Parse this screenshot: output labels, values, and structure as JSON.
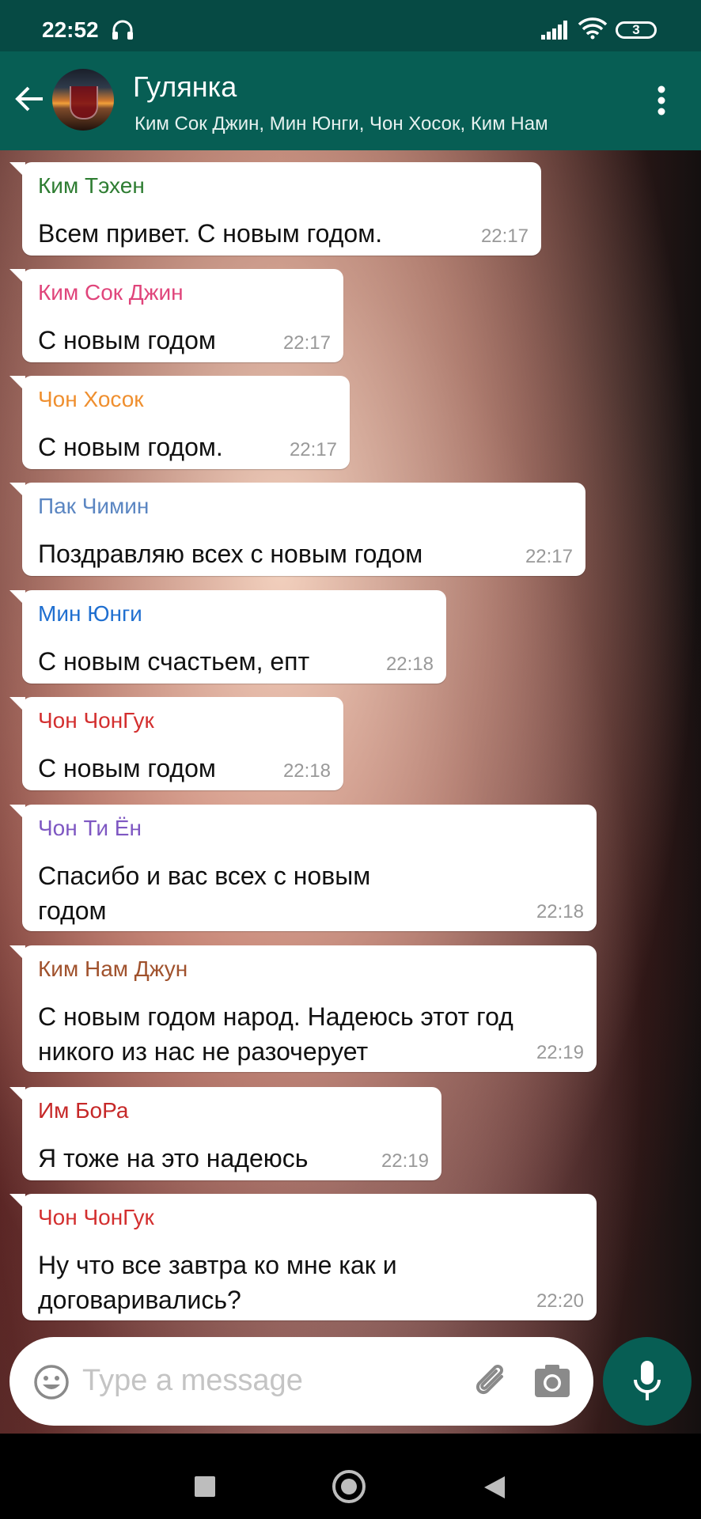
{
  "status_bar": {
    "time": "22:52",
    "battery": "3"
  },
  "header": {
    "title": "Гулянка",
    "subtitle": "Ким Сок Джин, Мин Юнги, Чон Хосок, Ким Нам"
  },
  "messages": [
    {
      "sender": "Ким Тэхен",
      "sender_color": "#2e7d32",
      "lines": [
        "Всем привет. С новым годом."
      ],
      "time": "22:17"
    },
    {
      "sender": "Ким Сок Джин",
      "sender_color": "#e0457b",
      "lines": [
        "С новым годом"
      ],
      "time": "22:17"
    },
    {
      "sender": "Чон Хосок",
      "sender_color": "#ef8f2f",
      "lines": [
        "С новым годом."
      ],
      "time": "22:17"
    },
    {
      "sender": "Пак Чимин",
      "sender_color": "#5b86c2",
      "lines": [
        "Поздравляю всех с новым годом"
      ],
      "time": "22:17"
    },
    {
      "sender": "Мин Юнги",
      "sender_color": "#1f6fd0",
      "lines": [
        "С новым счастьем, епт"
      ],
      "time": "22:18"
    },
    {
      "sender": "Чон ЧонГук",
      "sender_color": "#d32f2f",
      "lines": [
        "С новым годом"
      ],
      "time": "22:18"
    },
    {
      "sender": "Чон Ти Ён",
      "sender_color": "#7e57c2",
      "lines": [
        "Спасибо и вас всех с новым",
        "годом"
      ],
      "time": "22:18"
    },
    {
      "sender": "Ким Нам Джун",
      "sender_color": "#a0522d",
      "lines": [
        "С новым годом народ. Надеюсь этот год",
        "никого из нас не разочерует"
      ],
      "time": "22:19"
    },
    {
      "sender": "Им БоРа",
      "sender_color": "#c62828",
      "lines": [
        "Я тоже на это надеюсь"
      ],
      "time": "22:19"
    },
    {
      "sender": "Чон ЧонГук",
      "sender_color": "#d32f2f",
      "lines": [
        "Ну что все завтра ко мне как и",
        "договаривались?"
      ],
      "time": "22:20"
    }
  ],
  "composer": {
    "placeholder": "Type a message"
  },
  "colors": {
    "header": "#075e54",
    "status_bar": "#064a44",
    "mic_button": "#075e54"
  }
}
